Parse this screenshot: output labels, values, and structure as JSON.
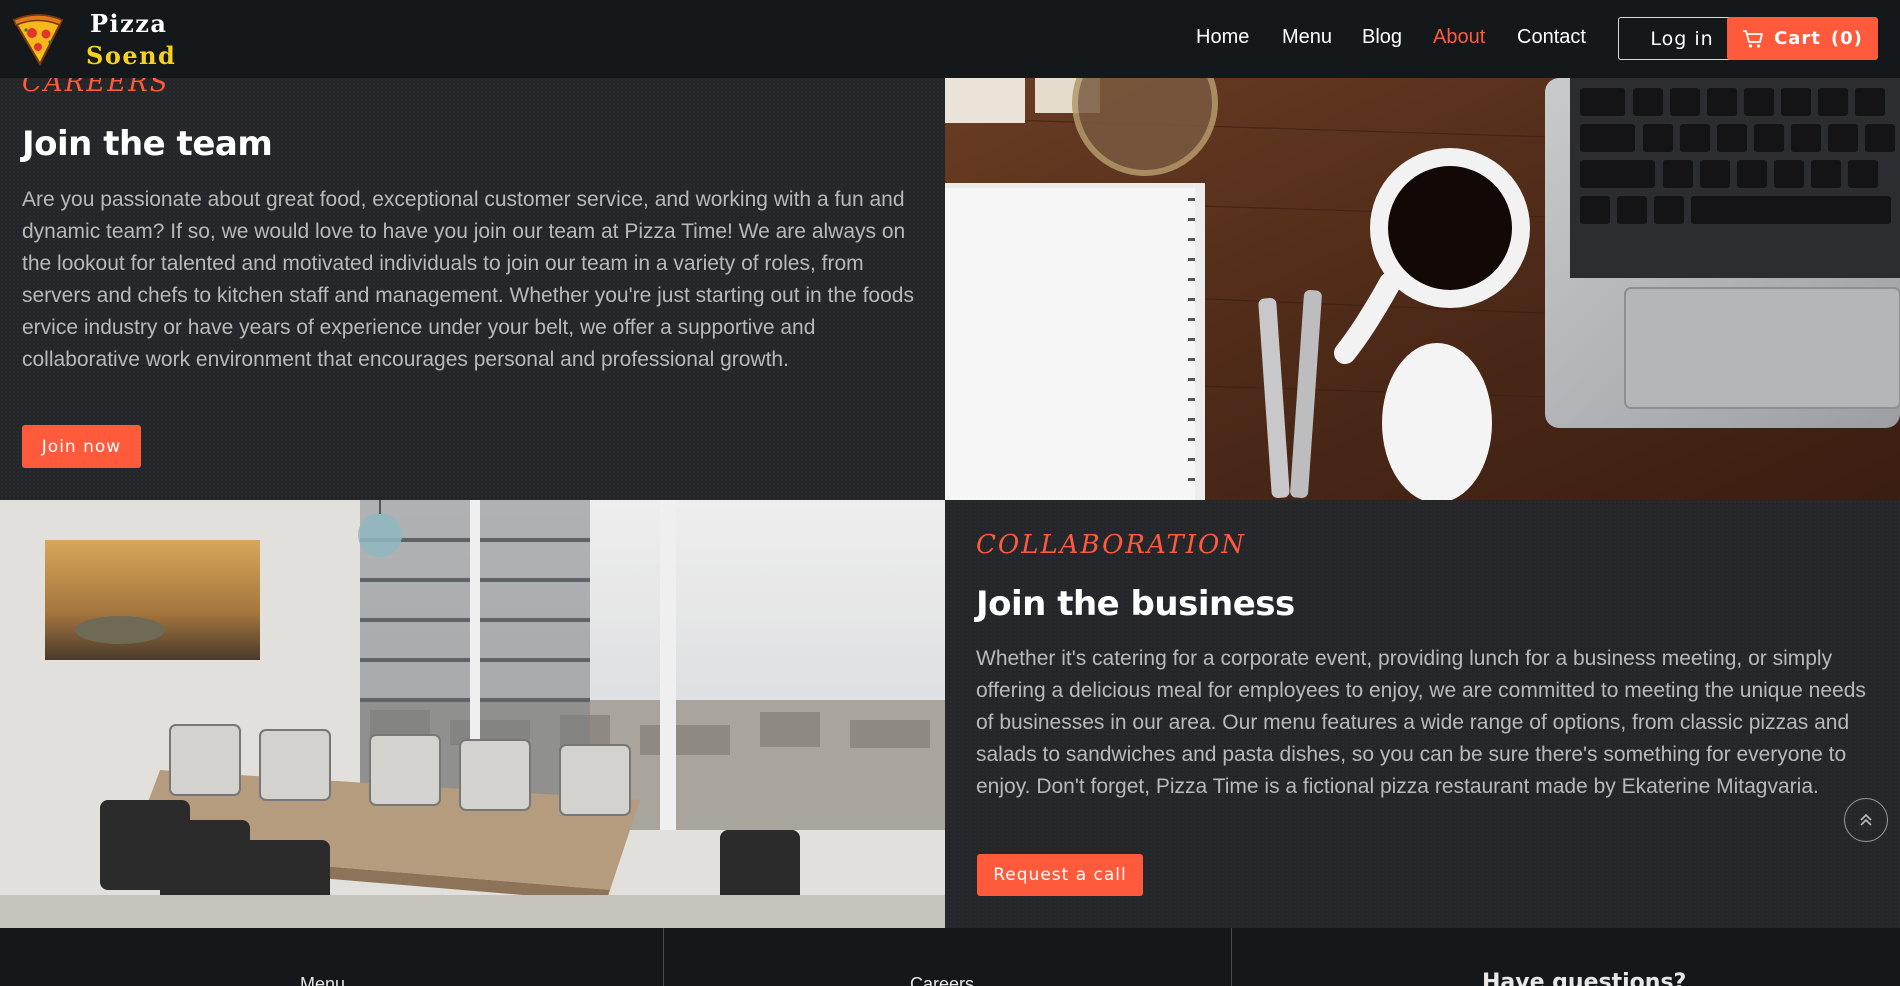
{
  "brand": {
    "line1": "Pizza",
    "line2": "Soend"
  },
  "nav": {
    "items": [
      {
        "label": "Home"
      },
      {
        "label": "Menu"
      },
      {
        "label": "Blog"
      },
      {
        "label": "About",
        "active": true
      },
      {
        "label": "Contact"
      }
    ],
    "login_label": "Log in",
    "cart_label": "Cart",
    "cart_count": "(0)"
  },
  "careers": {
    "eyebrow": "CAREERS",
    "title": "Join the team",
    "body": "Are you passionate about great food, exceptional customer service, and working with a fun and dynamic team? If so, we would love to have you join our team at Pizza Time! We are always on the lookout for talented and motivated individuals to join our team in a variety of roles, from servers and chefs to kitchen staff and management. Whether you're just starting out in the foods ervice industry or have years of experience under your belt, we offer a supportive and collaborative work environment that encourages personal and professional growth.",
    "button": "Join now"
  },
  "collaboration": {
    "eyebrow": "COLLABORATION",
    "title": "Join the business",
    "body": "Whether it's catering for a corporate event, providing lunch for a business meeting, or simply offering a delicious meal for employees to enjoy, we are committed to meeting the unique needs of businesses in our area. Our menu features a wide range of options, from classic pizzas and salads to sandwiches and pasta dishes, so you can be sure there's something for everyone to enjoy. Don't forget, Pizza Time is a fictional pizza restaurant made by Ekaterine Mitagvaria.",
    "button": "Request a call"
  },
  "footer": {
    "col1": "Menu",
    "col2": "Careers",
    "col3": "Have questions?"
  },
  "colors": {
    "accent": "#ff5a3c",
    "header_bg": "#15181b",
    "section_bg": "#25262a",
    "brand_yellow": "#f6d21c"
  },
  "icons": [
    "pizza-logo-icon",
    "cart-icon",
    "chevron-up-icon"
  ]
}
